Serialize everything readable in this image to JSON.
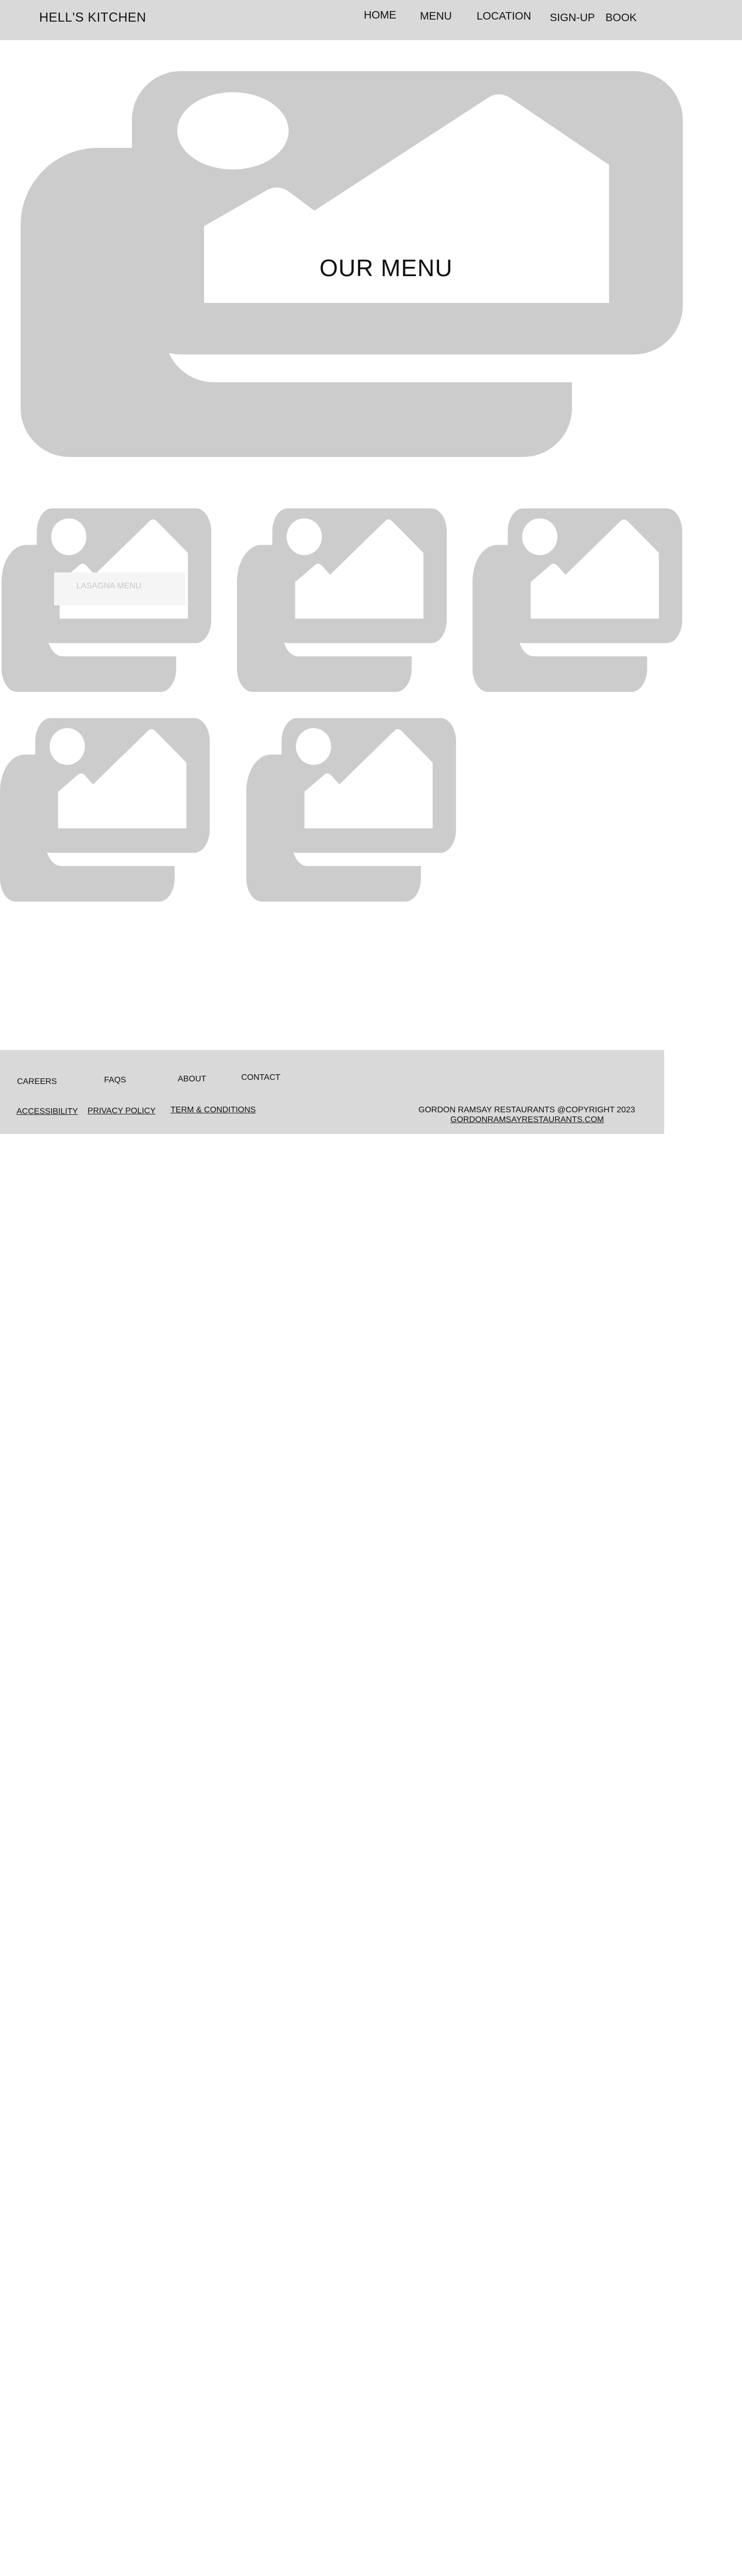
{
  "brand": {
    "name": "HELL'S KITCHEN"
  },
  "nav": {
    "home": "HOME",
    "menu": "MENU",
    "location": "LOCATION",
    "signup": "SIGN-UP",
    "book": "BOOK"
  },
  "hero": {
    "title": "OUR MENU",
    "image_icon": "image-placeholder-icon"
  },
  "menu_items": [
    {
      "label": "LASAGNA MENU",
      "image_icon": "image-placeholder-icon"
    },
    {
      "label": "",
      "image_icon": "image-placeholder-icon"
    },
    {
      "label": "",
      "image_icon": "image-placeholder-icon"
    },
    {
      "label": "",
      "image_icon": "image-placeholder-icon"
    },
    {
      "label": "",
      "image_icon": "image-placeholder-icon"
    }
  ],
  "footer": {
    "careers": "CAREERS",
    "faqs": "FAQS",
    "about": "ABOUT",
    "contact": "CONTACT",
    "accessibility": "ACCESSIBILITY",
    "privacy": "PRIVACY POLICY",
    "terms": "TERM & CONDITIONS",
    "copyright": "GORDON RAMSAY RESTAURANTS @COPYRIGHT 2023",
    "website": "GORDONRAMSAYRESTAURANTS.COM"
  },
  "colors": {
    "header_bg": "#d9d9d9",
    "footer_bg": "#d9d9d9",
    "placeholder_gray": "#cccccc",
    "card_label_bg": "#f5f5f5",
    "card_label_text": "#c9c9c9"
  }
}
